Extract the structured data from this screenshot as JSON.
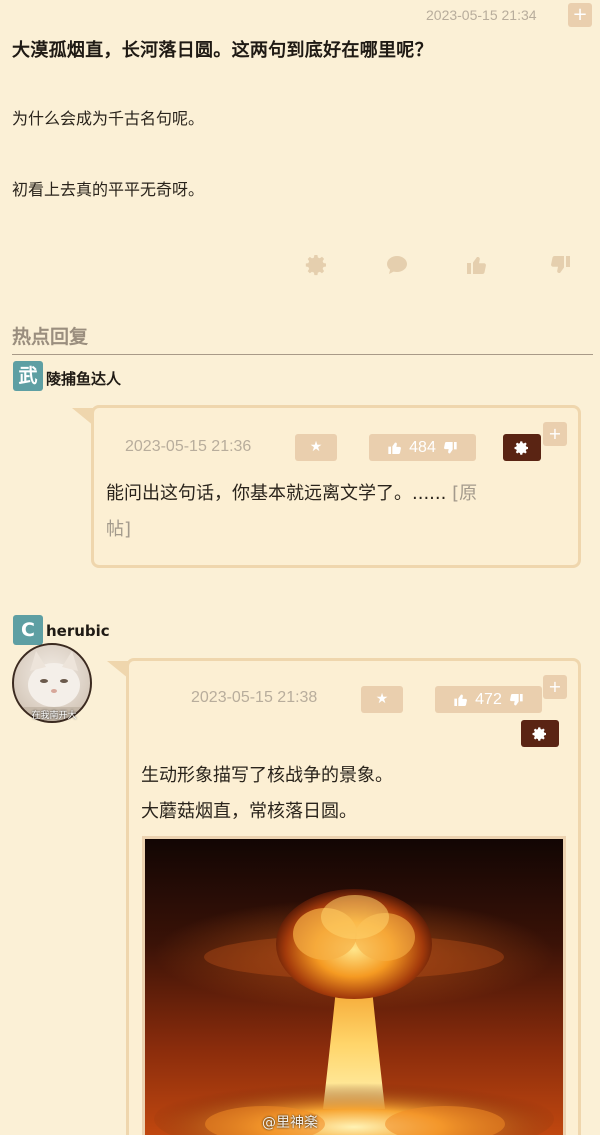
{
  "post": {
    "timestamp": "2023-05-15 21:34",
    "plus_label": "+",
    "title": "大漠孤烟直，长河落日圆。这两句到底好在哪里呢？",
    "lines": [
      "为什么会成为千古名句呢。",
      "初看上去真的平平无奇呀。"
    ],
    "actions": [
      "gear-icon",
      "comment-icon",
      "thumbs-up-icon",
      "thumbs-down-icon"
    ]
  },
  "hot_replies": {
    "heading": "热点回复"
  },
  "reply1": {
    "badge": "武",
    "username": "陵捕鱼达人",
    "timestamp": "2023-05-15 21:36",
    "star_label": "★",
    "votes": "484",
    "plus_label": "+",
    "text_line1": "能问出这句话，你基本就远离文学了。......",
    "link_part1": "[原",
    "link_part2": "帖]"
  },
  "reply2": {
    "badge": "C",
    "username": "herubic",
    "avatar_caption": "在我南开大",
    "timestamp": "2023-05-15 21:38",
    "star_label": "★",
    "votes": "472",
    "plus_label": "+",
    "text_line1": "生动形象描写了核战争的景象。",
    "text_line2": "大蘑菇烟直，常核落日圆。"
  },
  "watermark": "@里神楽",
  "colors": {
    "background": "#fbf0d6",
    "card_border": "#efd6ad",
    "button_tan": "#eacfae",
    "gear_dark": "#5a2413",
    "badge_teal": "#5e9fa3"
  }
}
